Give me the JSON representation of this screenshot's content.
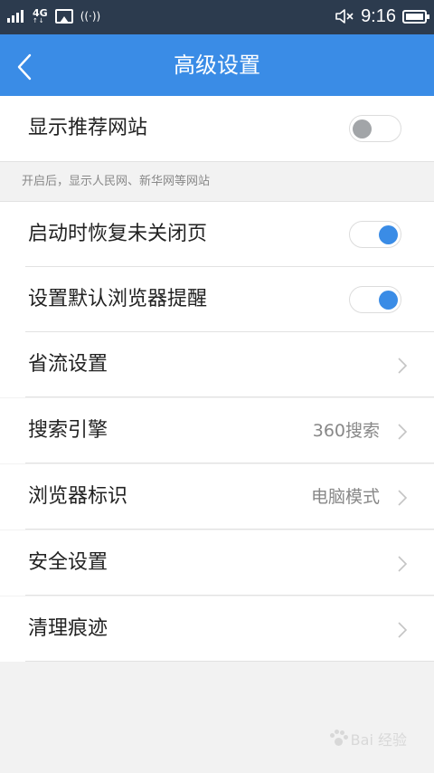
{
  "status_bar": {
    "network": "4G",
    "network_arrows": "↑↓",
    "time": "9:16",
    "icons": [
      "signal-icon",
      "image-notification-icon",
      "hotspot-icon",
      "mute-icon",
      "battery-icon"
    ]
  },
  "header": {
    "title": "高级设置",
    "back_icon": "chevron-left-icon",
    "color": "#3a8ce6"
  },
  "settings": {
    "recommend_sites": {
      "label": "显示推荐网站",
      "enabled": false
    },
    "recommend_hint": "开启后，显示人民网、新华网等网站",
    "restore_pages": {
      "label": "启动时恢复未关闭页",
      "enabled": true
    },
    "default_browser_reminder": {
      "label": "设置默认浏览器提醒",
      "enabled": true
    },
    "data_saving": {
      "label": "省流设置"
    },
    "search_engine": {
      "label": "搜索引擎",
      "value": "360搜索"
    },
    "browser_ua": {
      "label": "浏览器标识",
      "value": "电脑模式"
    },
    "security": {
      "label": "安全设置"
    },
    "clear_traces": {
      "label": "清理痕迹"
    }
  },
  "watermark": {
    "text": "Bai 经验"
  }
}
